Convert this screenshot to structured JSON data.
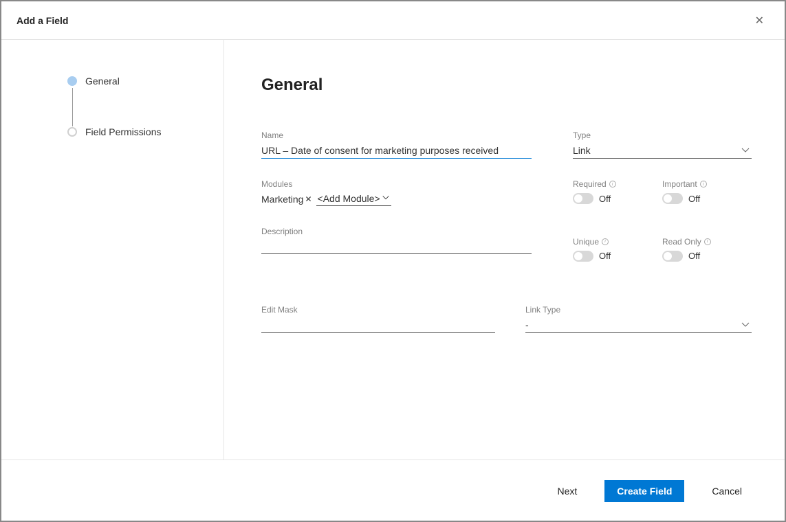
{
  "header": {
    "title": "Add a Field"
  },
  "sidebar": {
    "steps": [
      {
        "label": "General",
        "active": true
      },
      {
        "label": "Field Permissions",
        "active": false
      }
    ]
  },
  "main": {
    "title": "General",
    "name": {
      "label": "Name",
      "value": "URL – Date of consent for marketing purposes received"
    },
    "type": {
      "label": "Type",
      "value": "Link"
    },
    "modules": {
      "label": "Modules",
      "chip": "Marketing",
      "add_label": "<Add Module>"
    },
    "description": {
      "label": "Description",
      "value": ""
    },
    "toggles": {
      "required": {
        "label": "Required",
        "state": "Off"
      },
      "important": {
        "label": "Important",
        "state": "Off"
      },
      "unique": {
        "label": "Unique",
        "state": "Off"
      },
      "readonly": {
        "label": "Read Only",
        "state": "Off"
      }
    },
    "edit_mask": {
      "label": "Edit Mask",
      "value": ""
    },
    "link_type": {
      "label": "Link Type",
      "value": "-"
    }
  },
  "footer": {
    "next": "Next",
    "create": "Create Field",
    "cancel": "Cancel"
  }
}
